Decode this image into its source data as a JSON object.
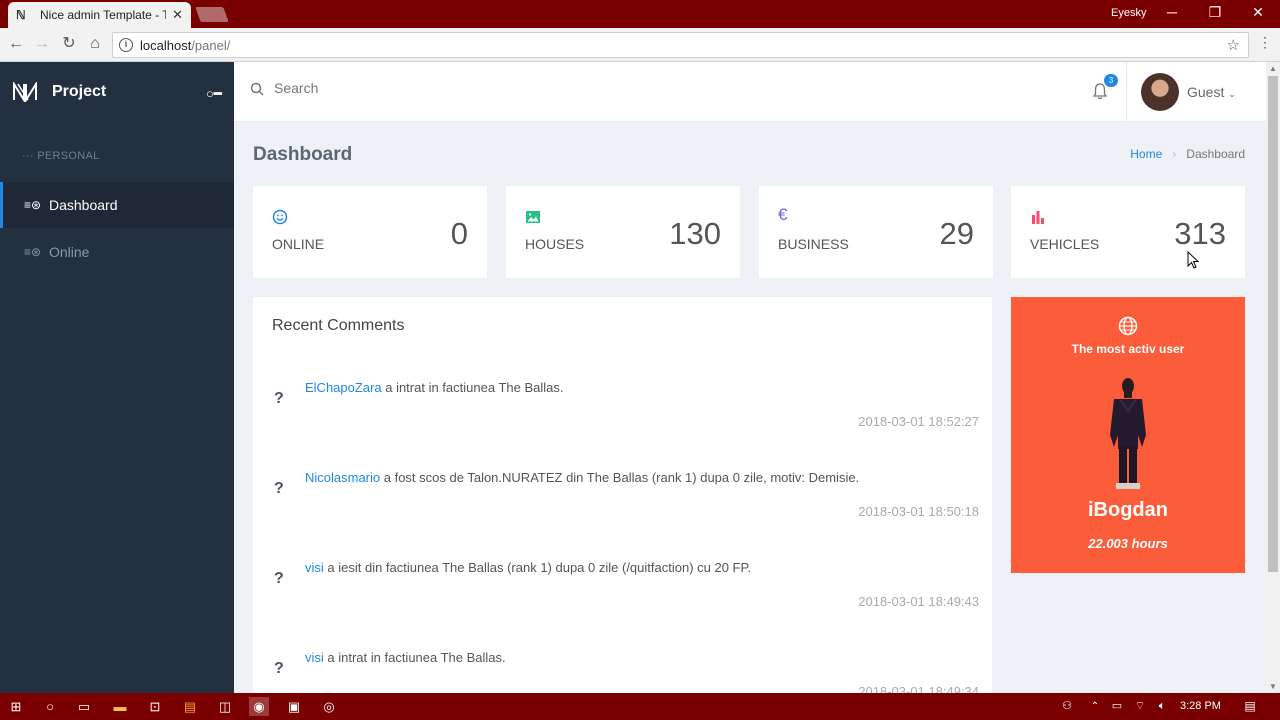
{
  "browser": {
    "tab_title": "Nice admin Template - Th",
    "user_label": "Eyesky",
    "url_host": "localhost",
    "url_path": "/panel/"
  },
  "sidebar": {
    "brand": "Project",
    "section": "PERSONAL",
    "items": [
      {
        "label": "Dashboard",
        "active": true
      },
      {
        "label": "Online",
        "active": false
      }
    ]
  },
  "header": {
    "search_placeholder": "Search",
    "notifications": "3",
    "user": "Guest"
  },
  "page": {
    "title": "Dashboard",
    "breadcrumb": [
      "Home",
      "Dashboard"
    ]
  },
  "stats": [
    {
      "label": "ONLINE",
      "value": "0",
      "icon": "smile-icon",
      "color": "#1e88e5"
    },
    {
      "label": "HOUSES",
      "value": "130",
      "icon": "image-icon",
      "color": "#26c281"
    },
    {
      "label": "BUSINESS",
      "value": "29",
      "icon": "euro-icon",
      "color": "#7460ee"
    },
    {
      "label": "VEHICLES",
      "value": "313",
      "icon": "bar-chart-icon",
      "color": "#fc4b6c"
    }
  ],
  "comments": {
    "title": "Recent Comments",
    "items": [
      {
        "user": "ElChapoZara",
        "text": " a intrat in factiunea The Ballas.",
        "time": "2018-03-01 18:52:27"
      },
      {
        "user": "Nicolasmario",
        "text": " a fost scos de Talon.NURATEZ din The Ballas (rank 1) dupa 0 zile, motiv: Demisie.",
        "time": "2018-03-01 18:50:18"
      },
      {
        "user": "visi",
        "text": " a iesit din factiunea The Ballas (rank 1) dupa 0 zile (/quitfaction) cu 20 FP.",
        "time": "2018-03-01 18:49:43"
      },
      {
        "user": "visi",
        "text": " a intrat in factiunea The Ballas.",
        "time": "2018-03-01 18:49:34"
      }
    ]
  },
  "top_user": {
    "heading": "The most activ user",
    "name": "iBogdan",
    "hours": "22.003 hours",
    "color": "#fb5c3a"
  },
  "taskbar": {
    "time": "3:28 PM"
  }
}
